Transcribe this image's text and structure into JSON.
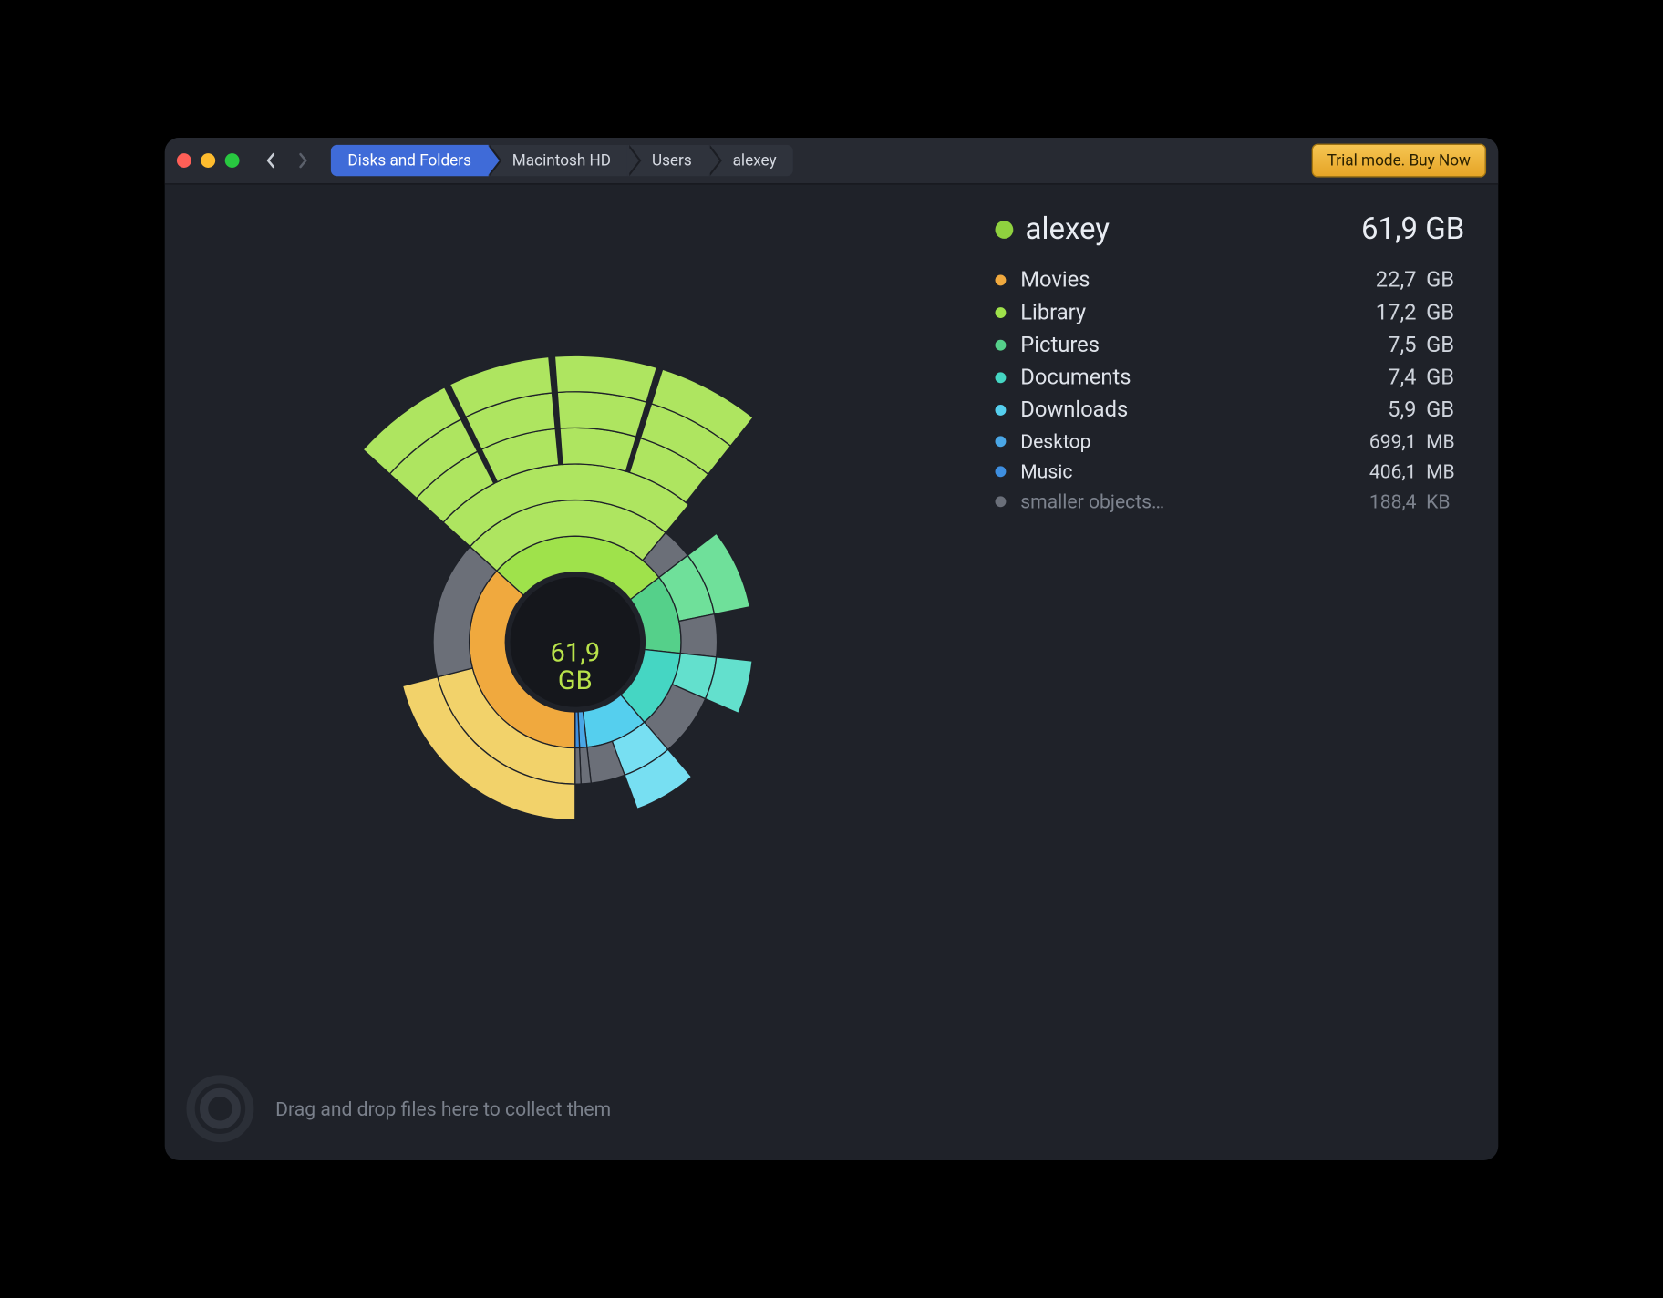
{
  "toolbar": {
    "breadcrumbs": [
      "Disks and Folders",
      "Macintosh HD",
      "Users",
      "alexey"
    ],
    "active_index": 0,
    "buy_label": "Trial mode. Buy Now"
  },
  "summary": {
    "name": "alexey",
    "size": "61,9 GB",
    "color": "#8fd13f"
  },
  "items": [
    {
      "name": "Movies",
      "size_num": "22,7",
      "size_unit": "GB",
      "color": "#f0a93e"
    },
    {
      "name": "Library",
      "size_num": "17,2",
      "size_unit": "GB",
      "color": "#9fe24b"
    },
    {
      "name": "Pictures",
      "size_num": "7,5",
      "size_unit": "GB",
      "color": "#55d08a"
    },
    {
      "name": "Documents",
      "size_num": "7,4",
      "size_unit": "GB",
      "color": "#45d6c3"
    },
    {
      "name": "Downloads",
      "size_num": "5,9",
      "size_unit": "GB",
      "color": "#55cfee"
    },
    {
      "name": "Desktop",
      "size_num": "699,1",
      "size_unit": "MB",
      "color": "#4aa7e6",
      "sm": true
    },
    {
      "name": "Music",
      "size_num": "406,1",
      "size_unit": "MB",
      "color": "#3e8fe0",
      "sm": true
    },
    {
      "name": "smaller objects…",
      "size_num": "188,4",
      "size_unit": "KB",
      "color": "#6a6f79",
      "small": true,
      "sm": true
    }
  ],
  "center_label_top": "61,9",
  "center_label_bottom": "GB",
  "footer_hint": "Drag and drop files here to collect them",
  "chart_data": {
    "type": "sunburst",
    "title": "Disk usage — alexey",
    "total_label": "61,9 GB",
    "units": "GB",
    "categories": [
      "Movies",
      "Library",
      "Pictures",
      "Documents",
      "Downloads",
      "Desktop",
      "Music",
      "smaller objects…"
    ],
    "values_gb": [
      22.7,
      17.2,
      7.5,
      7.4,
      5.9,
      0.6991,
      0.4061,
      0.0001884
    ],
    "pretty": [
      "22,7 GB",
      "17,2 GB",
      "7,5 GB",
      "7,4 GB",
      "5,9 GB",
      "699,1 MB",
      "406,1 MB",
      "188,4 KB"
    ],
    "colors": [
      "#f0a93e",
      "#9fe24b",
      "#55d08a",
      "#45d6c3",
      "#55cfee",
      "#4aa7e6",
      "#3e8fe0",
      "#6a6f79"
    ],
    "children": {
      "Movies": [
        {
          "gb": 13.0,
          "color": "#f2d26a"
        },
        {
          "gb": 9.7,
          "grey": true
        }
      ],
      "Library": [
        {
          "gb": 15.0,
          "color": "#aee560",
          "depth": 5
        },
        {
          "gb": 2.2,
          "grey": true
        }
      ],
      "Pictures": [
        {
          "gb": 4.5,
          "color": "#6fe09a"
        },
        {
          "gb": 3.0,
          "grey": true
        }
      ],
      "Documents": [
        {
          "gb": 3.0,
          "color": "#63e0cd"
        },
        {
          "gb": 4.4,
          "grey": true
        }
      ],
      "Downloads": [
        {
          "gb": 3.5,
          "color": "#77dff2"
        },
        {
          "gb": 2.4,
          "grey": true
        }
      ],
      "Desktop": [
        {
          "gb": 0.7,
          "grey": true
        }
      ],
      "Music": [
        {
          "gb": 0.4,
          "grey": true
        }
      ]
    }
  }
}
